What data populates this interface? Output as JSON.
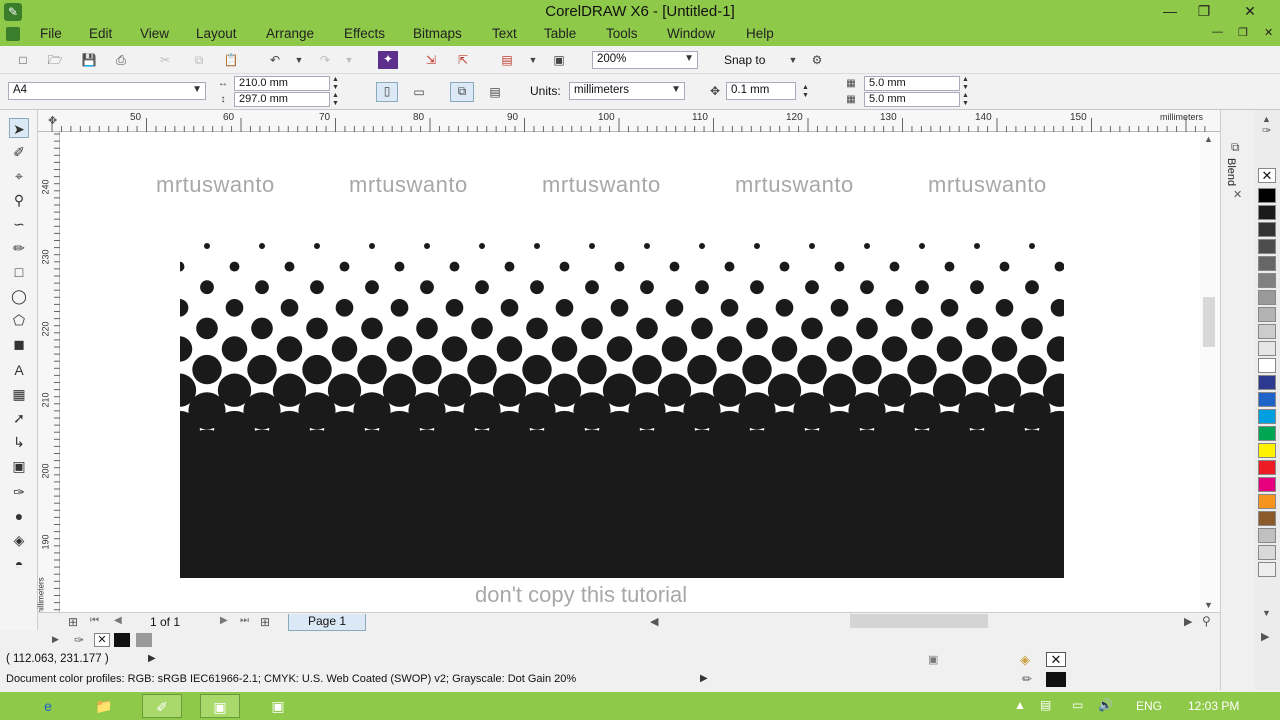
{
  "window": {
    "title": "CorelDRAW X6 - [Untitled-1]"
  },
  "menu": [
    "File",
    "Edit",
    "View",
    "Layout",
    "Arrange",
    "Effects",
    "Bitmaps",
    "Text",
    "Table",
    "Tools",
    "Window",
    "Help"
  ],
  "toolbar": {
    "zoom": "200%",
    "snap_label": "Snap to"
  },
  "property_bar": {
    "page_size": "A4",
    "width": "210.0 mm",
    "height": "297.0 mm",
    "units_label": "Units:",
    "units_value": "millimeters",
    "nudge": "0.1 mm",
    "dup_x": "5.0 mm",
    "dup_y": "5.0 mm"
  },
  "ruler": {
    "h_labels": [
      "50",
      "60",
      "70",
      "80",
      "90",
      "100",
      "110",
      "120",
      "130",
      "140",
      "150"
    ],
    "h_unit": "millimeters",
    "v_labels": [
      "240",
      "230",
      "220",
      "210",
      "200",
      "190"
    ],
    "v_unit": "millimeters"
  },
  "canvas": {
    "watermarks": [
      "mrtuswanto",
      "mrtuswanto",
      "mrtuswanto",
      "mrtuswanto",
      "mrtuswanto"
    ],
    "footer_text": "don't copy this tutorial"
  },
  "page_nav": {
    "count": "1 of 1",
    "tab": "Page 1"
  },
  "docker": {
    "label": "Blend"
  },
  "status": {
    "coords": "( 112.063, 231.177 )",
    "color_profiles": "Document color profiles: RGB: sRGB IEC61966-2.1; CMYK: U.S. Web Coated (SWOP) v2; Grayscale: Dot Gain 20%"
  },
  "taskbar": {
    "lang": "ENG",
    "time": "12:03 PM"
  },
  "palette_colors": [
    "#000000",
    "#1a1a1a",
    "#333333",
    "#4d4d4d",
    "#666666",
    "#808080",
    "#999999",
    "#b3b3b3",
    "#cccccc",
    "#e6e6e6",
    "#ffffff",
    "#2b3a8f",
    "#1e64c8",
    "#00a0e0",
    "#00a651",
    "#fff200",
    "#ed1c24",
    "#e6007e",
    "#f7941d",
    "#8b5a2b",
    "#c0c0c0",
    "#d9d9d9",
    "#eeeeee"
  ]
}
